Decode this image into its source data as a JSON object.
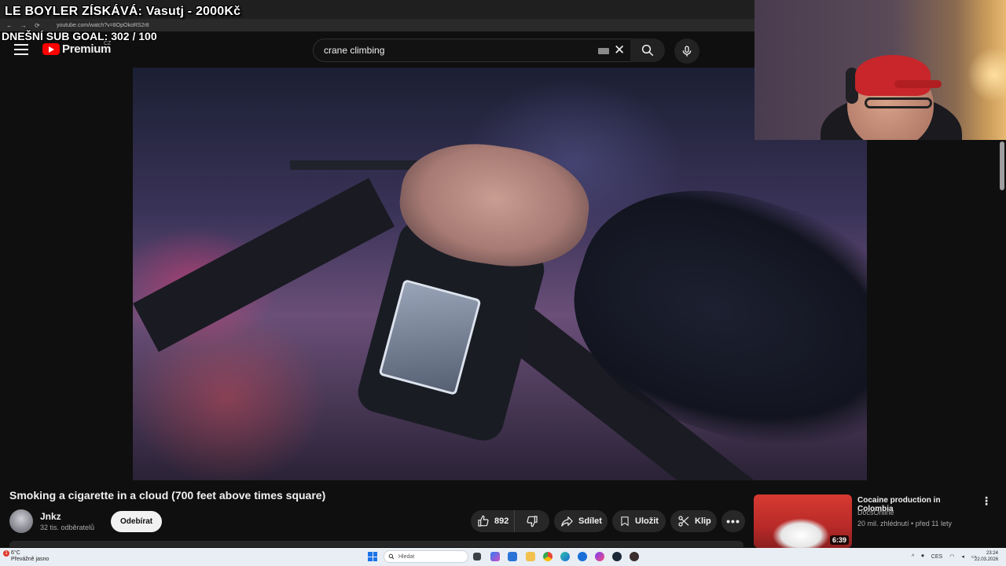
{
  "overlay": {
    "title": "LE BOYLER ZÍSKÁVÁ: Vasutj - 2000Kč",
    "sub_goal": "DNEŠNÍ SUB GOAL:  302 / 100"
  },
  "browser": {
    "url": "youtube.com/watch?v=8OpOkoRS2r8"
  },
  "header": {
    "logo_text": "Premium",
    "country": "CZ",
    "search_value": "crane climbing"
  },
  "video": {
    "title": "Smoking a cigarette in a cloud (700 feet above times square)"
  },
  "channel": {
    "name": "Jnkz",
    "subscribers": "32 tis. odběratelů",
    "subscribe_label": "Odebírat"
  },
  "actions": {
    "likes": "892",
    "share": "Sdílet",
    "save": "Uložit",
    "clip": "Klip"
  },
  "recommendation": {
    "title": "Cocaine production in Colombia",
    "channel": "DocsOnline",
    "meta": "20 mil. zhlédnutí • před 11 lety",
    "duration": "6:39"
  },
  "taskbar": {
    "weather_temp": "6°C",
    "weather_desc": "Převážně jasno",
    "weather_badge": "1",
    "search_placeholder": "Hledat",
    "lang": "CES",
    "time": "23:24",
    "date": "22.03.2026"
  },
  "colors": {
    "accent_red": "#ff0000",
    "background": "#0f0f0f",
    "pill_bg": "#272727"
  }
}
